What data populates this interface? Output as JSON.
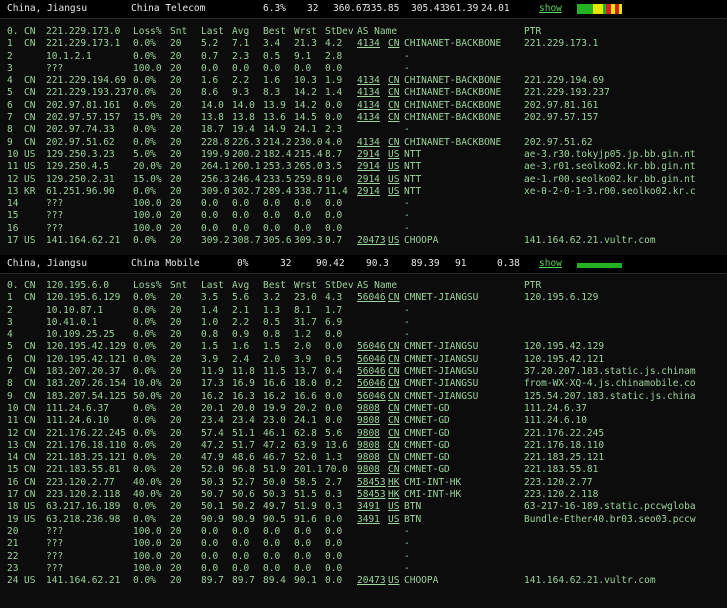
{
  "panels": [
    {
      "header": {
        "location": "China, Jiangsu",
        "isp": "China Telecom",
        "loss": "6.3%",
        "snt": "32",
        "last": "360.67",
        "avg": "335.85",
        "best": "305.43",
        "wrst": "361.39",
        "stdev": "24.01",
        "show": "show"
      },
      "columns": [
        "0.",
        "CN",
        "221.229.173.0",
        "Loss%",
        "Snt",
        "Last",
        "Avg",
        "Best",
        "Wrst",
        "StDev",
        "AS Name",
        "PTR"
      ],
      "rows": [
        [
          "1",
          "CN",
          "221.229.173.1",
          "0.0%",
          "20",
          "5.2",
          "7.1",
          "3.4",
          "21.3",
          "4.2",
          "4134",
          "CN",
          "CHINANET-BACKBONE",
          "221.229.173.1"
        ],
        [
          "2",
          "",
          "10.1.2.1",
          "0.0%",
          "20",
          "0.7",
          "2.3",
          "0.5",
          "9.1",
          "2.8",
          "",
          "",
          "-",
          ""
        ],
        [
          "3",
          "",
          "???",
          "100.0",
          "20",
          "0.0",
          "0.0",
          "0.0",
          "0.0",
          "0.0",
          "",
          "",
          "-",
          ""
        ],
        [
          "4",
          "CN",
          "221.229.194.69",
          "0.0%",
          "20",
          "1.6",
          "2.2",
          "1.6",
          "10.3",
          "1.9",
          "4134",
          "CN",
          "CHINANET-BACKBONE",
          "221.229.194.69"
        ],
        [
          "5",
          "CN",
          "221.229.193.237",
          "0.0%",
          "20",
          "8.6",
          "9.3",
          "8.3",
          "14.2",
          "1.4",
          "4134",
          "CN",
          "CHINANET-BACKBONE",
          "221.229.193.237"
        ],
        [
          "6",
          "CN",
          "202.97.81.161",
          "0.0%",
          "20",
          "14.0",
          "14.0",
          "13.9",
          "14.2",
          "0.0",
          "4134",
          "CN",
          "CHINANET-BACKBONE",
          "202.97.81.161"
        ],
        [
          "7",
          "CN",
          "202.97.57.157",
          "15.0%",
          "20",
          "13.8",
          "13.8",
          "13.6",
          "14.5",
          "0.0",
          "4134",
          "CN",
          "CHINANET-BACKBONE",
          "202.97.57.157"
        ],
        [
          "8",
          "CN",
          "202.97.74.33",
          "0.0%",
          "20",
          "18.7",
          "19.4",
          "14.9",
          "24.1",
          "2.3",
          "",
          "",
          "-",
          ""
        ],
        [
          "9",
          "CN",
          "202.97.51.62",
          "0.0%",
          "20",
          "228.8",
          "226.3",
          "214.2",
          "230.0",
          "4.0",
          "4134",
          "CN",
          "CHINANET-BACKBONE",
          "202.97.51.62"
        ],
        [
          "10",
          "US",
          "129.250.3.23",
          "5.0%",
          "20",
          "199.9",
          "200.2",
          "182.4",
          "215.4",
          "8.7",
          "2914",
          "US",
          "NTT",
          "ae-3.r30.tokyjp05.jp.bb.gin.nt"
        ],
        [
          "11",
          "US",
          "129.250.4.5",
          "20.0%",
          "20",
          "264.1",
          "260.1",
          "253.3",
          "265.0",
          "3.5",
          "2914",
          "US",
          "NTT",
          "ae-3.r01.seolko02.kr.bb.gin.nt"
        ],
        [
          "12",
          "US",
          "129.250.2.31",
          "15.0%",
          "20",
          "256.3",
          "246.4",
          "233.5",
          "259.8",
          "9.0",
          "2914",
          "US",
          "NTT",
          "ae-1.r00.seolko02.kr.bb.gin.nt"
        ],
        [
          "13",
          "KR",
          "61.251.96.90",
          "0.0%",
          "20",
          "309.0",
          "302.7",
          "289.4",
          "338.7",
          "11.4",
          "2914",
          "US",
          "NTT",
          "xe-0-2-0-1-3.r00.seolko02.kr.c"
        ],
        [
          "14",
          "",
          "???",
          "100.0",
          "20",
          "0.0",
          "0.0",
          "0.0",
          "0.0",
          "0.0",
          "",
          "",
          "-",
          ""
        ],
        [
          "15",
          "",
          "???",
          "100.0",
          "20",
          "0.0",
          "0.0",
          "0.0",
          "0.0",
          "0.0",
          "",
          "",
          "-",
          ""
        ],
        [
          "16",
          "",
          "???",
          "100.0",
          "20",
          "0.0",
          "0.0",
          "0.0",
          "0.0",
          "0.0",
          "",
          "",
          "-",
          ""
        ],
        [
          "17",
          "US",
          "141.164.62.21",
          "0.0%",
          "20",
          "309.2",
          "308.7",
          "305.6",
          "309.3",
          "0.7",
          "20473",
          "US",
          "CHOOPA",
          "141.164.62.21.vultr.com"
        ]
      ]
    },
    {
      "header": {
        "location": "China, Jiangsu",
        "isp": "China Mobile",
        "loss": "0%",
        "snt": "32",
        "last": "90.42",
        "avg": "90.3",
        "best": "89.39",
        "wrst": "91",
        "stdev": "0.38",
        "show": "show"
      },
      "columns": [
        "0.",
        "CN",
        "120.195.6.0",
        "Loss%",
        "Snt",
        "Last",
        "Avg",
        "Best",
        "Wrst",
        "StDev",
        "AS Name",
        "PTR"
      ],
      "rows": [
        [
          "1",
          "CN",
          "120.195.6.129",
          "0.0%",
          "20",
          "3.5",
          "5.6",
          "3.2",
          "23.0",
          "4.3",
          "56046",
          "CN",
          "CMNET-JIANGSU",
          "120.195.6.129"
        ],
        [
          "2",
          "",
          "10.10.87.1",
          "0.0%",
          "20",
          "1.4",
          "2.1",
          "1.3",
          "8.1",
          "1.7",
          "",
          "",
          "-",
          ""
        ],
        [
          "3",
          "",
          "10.41.0.1",
          "0.0%",
          "20",
          "1.0",
          "2.2",
          "0.5",
          "31.7",
          "6.9",
          "",
          "",
          "-",
          ""
        ],
        [
          "4",
          "",
          "10.109.25.25",
          "0.0%",
          "20",
          "0.8",
          "0.9",
          "0.8",
          "1.2",
          "0.0",
          "",
          "",
          "-",
          ""
        ],
        [
          "5",
          "CN",
          "120.195.42.129",
          "0.0%",
          "20",
          "1.5",
          "1.6",
          "1.5",
          "2.0",
          "0.0",
          "56046",
          "CN",
          "CMNET-JIANGSU",
          "120.195.42.129"
        ],
        [
          "6",
          "CN",
          "120.195.42.121",
          "0.0%",
          "20",
          "3.9",
          "2.4",
          "2.0",
          "3.9",
          "0.5",
          "56046",
          "CN",
          "CMNET-JIANGSU",
          "120.195.42.121"
        ],
        [
          "7",
          "CN",
          "183.207.20.37",
          "0.0%",
          "20",
          "11.9",
          "11.8",
          "11.5",
          "13.7",
          "0.4",
          "56046",
          "CN",
          "CMNET-JIANGSU",
          "37.20.207.183.static.js.chinam"
        ],
        [
          "8",
          "CN",
          "183.207.26.154",
          "10.0%",
          "20",
          "17.3",
          "16.9",
          "16.6",
          "18.0",
          "0.2",
          "56046",
          "CN",
          "CMNET-JIANGSU",
          "from-WX-XQ-4.js.chinamobile.co"
        ],
        [
          "9",
          "CN",
          "183.207.54.125",
          "50.0%",
          "20",
          "16.2",
          "16.3",
          "16.2",
          "16.6",
          "0.0",
          "56046",
          "CN",
          "CMNET-JIANGSU",
          "125.54.207.183.static.js.china"
        ],
        [
          "10",
          "CN",
          "111.24.6.37",
          "0.0%",
          "20",
          "20.1",
          "20.0",
          "19.9",
          "20.2",
          "0.0",
          "9808",
          "CN",
          "CMNET-GD",
          "111.24.6.37"
        ],
        [
          "11",
          "CN",
          "111.24.6.10",
          "0.0%",
          "20",
          "23.4",
          "23.4",
          "23.0",
          "24.1",
          "0.0",
          "9808",
          "CN",
          "CMNET-GD",
          "111.24.6.10"
        ],
        [
          "12",
          "CN",
          "221.176.22.245",
          "0.0%",
          "20",
          "57.4",
          "51.1",
          "46.1",
          "62.8",
          "5.6",
          "9808",
          "CN",
          "CMNET-GD",
          "221.176.22.245"
        ],
        [
          "13",
          "CN",
          "221.176.18.110",
          "0.0%",
          "20",
          "47.2",
          "51.7",
          "47.2",
          "63.9",
          "13.6",
          "9808",
          "CN",
          "CMNET-GD",
          "221.176.18.110"
        ],
        [
          "14",
          "CN",
          "221.183.25.121",
          "0.0%",
          "20",
          "47.9",
          "48.6",
          "46.7",
          "52.0",
          "1.3",
          "9808",
          "CN",
          "CMNET-GD",
          "221.183.25.121"
        ],
        [
          "15",
          "CN",
          "221.183.55.81",
          "0.0%",
          "20",
          "52.0",
          "96.8",
          "51.9",
          "201.1",
          "70.0",
          "9808",
          "CN",
          "CMNET-GD",
          "221.183.55.81"
        ],
        [
          "16",
          "CN",
          "223.120.2.77",
          "40.0%",
          "20",
          "50.3",
          "52.7",
          "50.0",
          "58.5",
          "2.7",
          "58453",
          "HK",
          "CMI-INT-HK",
          "223.120.2.77"
        ],
        [
          "17",
          "CN",
          "223.120.2.118",
          "40.0%",
          "20",
          "50.7",
          "50.6",
          "50.3",
          "51.5",
          "0.3",
          "58453",
          "HK",
          "CMI-INT-HK",
          "223.120.2.118"
        ],
        [
          "18",
          "US",
          "63.217.16.189",
          "0.0%",
          "20",
          "50.1",
          "50.2",
          "49.7",
          "51.9",
          "0.3",
          "3491",
          "US",
          "BTN",
          "63-217-16-189.static.pccwgloba"
        ],
        [
          "19",
          "US",
          "63.218.236.98",
          "0.0%",
          "20",
          "90.9",
          "90.9",
          "90.5",
          "91.6",
          "0.0",
          "3491",
          "US",
          "BTN",
          "Bundle-Ether40.br03.seo03.pccw"
        ],
        [
          "20",
          "",
          "???",
          "100.0",
          "20",
          "0.0",
          "0.0",
          "0.0",
          "0.0",
          "0.0",
          "",
          "",
          "-",
          ""
        ],
        [
          "21",
          "",
          "???",
          "100.0",
          "20",
          "0.0",
          "0.0",
          "0.0",
          "0.0",
          "0.0",
          "",
          "",
          "-",
          ""
        ],
        [
          "22",
          "",
          "???",
          "100.0",
          "20",
          "0.0",
          "0.0",
          "0.0",
          "0.0",
          "0.0",
          "",
          "",
          "-",
          ""
        ],
        [
          "23",
          "",
          "???",
          "100.0",
          "20",
          "0.0",
          "0.0",
          "0.0",
          "0.0",
          "0.0",
          "",
          "",
          "-",
          ""
        ],
        [
          "24",
          "US",
          "141.164.62.21",
          "0.0%",
          "20",
          "89.7",
          "89.7",
          "89.4",
          "90.1",
          "0.0",
          "20473",
          "US",
          "CHOOPA",
          "141.164.62.21.vultr.com"
        ]
      ]
    }
  ],
  "colors": {
    "header_text": "#e8e8e8",
    "row_text": "#9bd39b",
    "link": "#5cd65c",
    "bar_green": "#22b322",
    "bar_yellow": "#e6e600",
    "bar_red": "#d92020"
  }
}
